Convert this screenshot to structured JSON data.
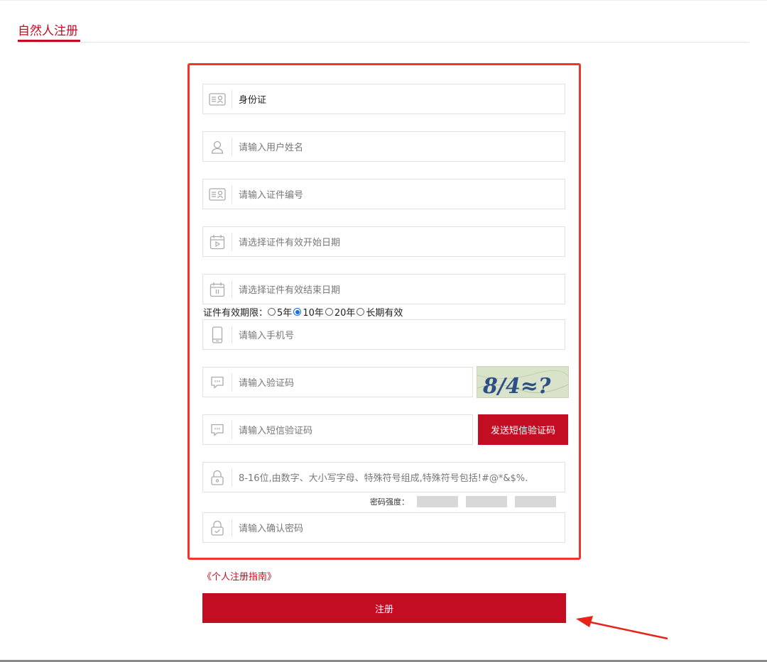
{
  "header": {
    "title": "自然人注册"
  },
  "form": {
    "id_type": {
      "value": "身份证",
      "icon": "id-card-icon"
    },
    "username": {
      "placeholder": "请输入用户姓名",
      "icon": "user-icon"
    },
    "id_number": {
      "placeholder": "请输入证件编号",
      "icon": "id-card-icon"
    },
    "start_date": {
      "placeholder": "请选择证件有效开始日期",
      "icon": "calendar-start-icon"
    },
    "end_date": {
      "placeholder": "请选择证件有效结束日期",
      "icon": "calendar-end-icon"
    },
    "validity": {
      "label": "证件有效期限：",
      "options": [
        "5年",
        "10年",
        "20年",
        "长期有效"
      ],
      "selected": "10年"
    },
    "phone": {
      "placeholder": "请输入手机号",
      "icon": "phone-icon"
    },
    "captcha": {
      "placeholder": "请输入验证码",
      "icon": "message-icon",
      "image_text": "8/4≈?"
    },
    "sms_code": {
      "placeholder": "请输入短信验证码",
      "icon": "message-icon",
      "button": "发送短信验证码"
    },
    "password": {
      "placeholder": "8-16位,由数字、大小写字母、特殊符号组成,特殊符号包括!#@*&$%.",
      "icon": "lock-icon"
    },
    "strength": {
      "label": "密码强度：",
      "levels": 3,
      "filled": 0
    },
    "confirm_password": {
      "placeholder": "请输入确认密码",
      "icon": "lock-check-icon"
    }
  },
  "guide_link": "《个人注册指南》",
  "register_button": "注册",
  "colors": {
    "accent": "#c30d23",
    "highlight": "#f0352b",
    "radio": "#1e6fd9"
  }
}
